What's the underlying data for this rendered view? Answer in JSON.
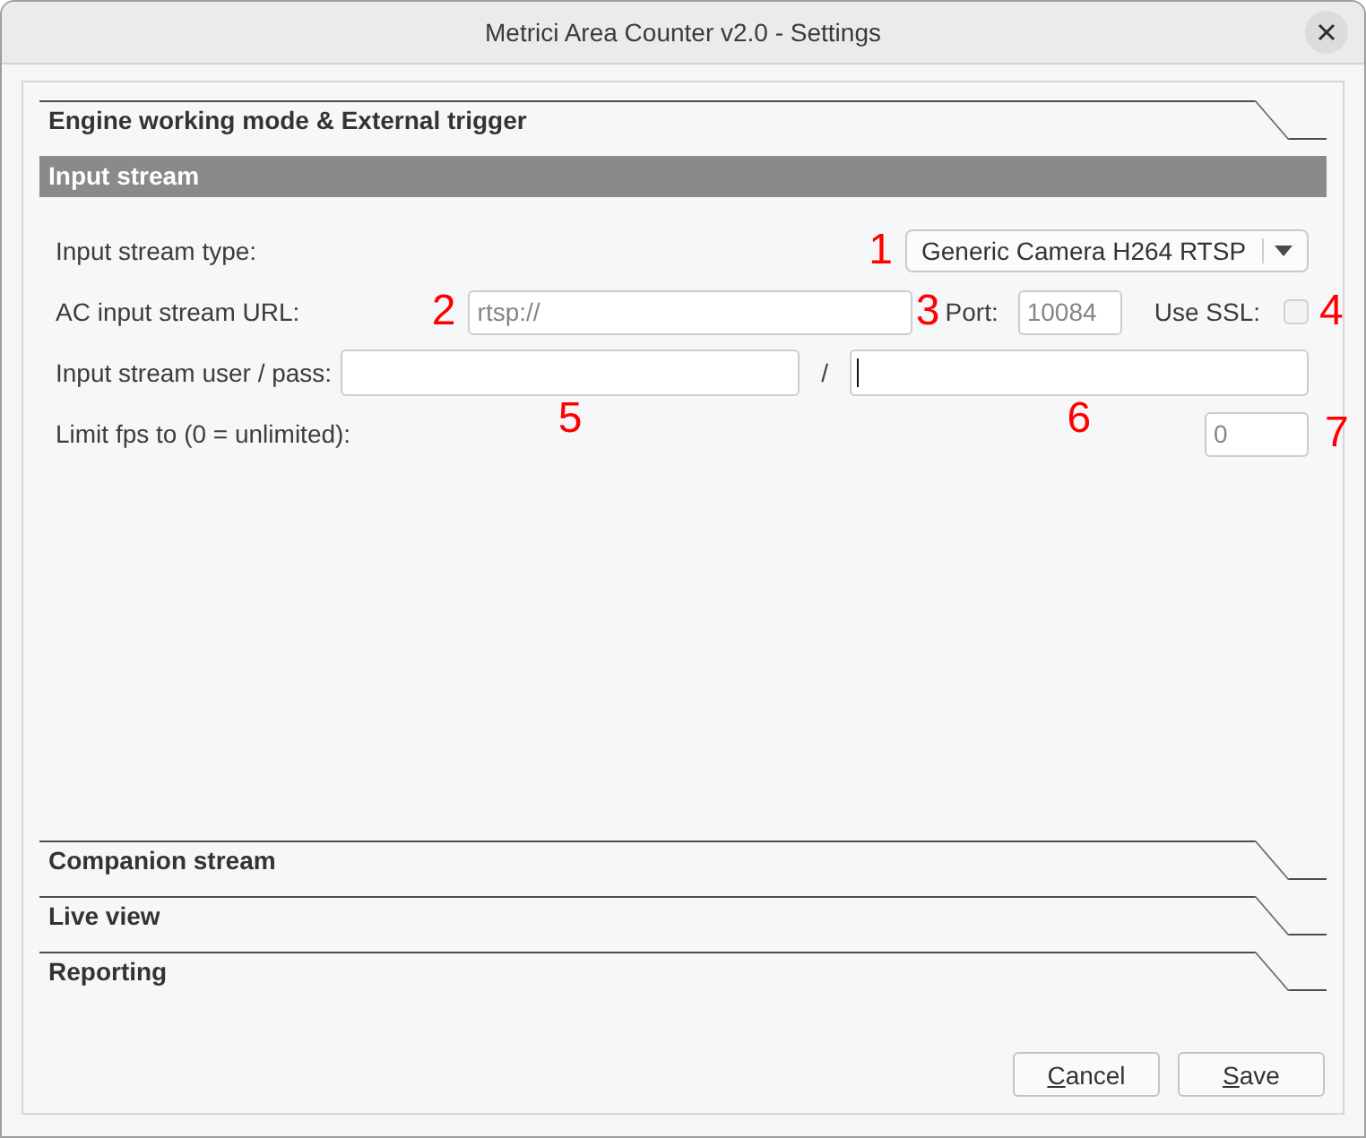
{
  "window": {
    "title": "Metrici Area Counter v2.0 - Settings"
  },
  "sections": [
    {
      "title": "Engine working mode & External trigger",
      "expanded": false
    },
    {
      "title": "Input stream",
      "expanded": true,
      "rows": [
        {
          "kind": "select",
          "label": "Input stream type:",
          "value": "Generic Camera H264 RTSP",
          "marker": "1"
        },
        {
          "kind": "url",
          "label": "AC input stream URL:",
          "url": {
            "placeholder": "rtsp://",
            "focused": false,
            "marker": "2"
          },
          "port": {
            "label": "Port:",
            "placeholder": "10084",
            "focused": false,
            "marker": "3"
          },
          "ssl": {
            "label": "Use SSL:",
            "checked": false,
            "marker": "4"
          }
        },
        {
          "kind": "credentials",
          "label": "Input stream user / pass:",
          "separator": "/",
          "user": {
            "focused": false,
            "marker": "5"
          },
          "pass": {
            "focused": true,
            "marker": "6"
          }
        },
        {
          "kind": "number",
          "label": "Limit fps to (0 = unlimited):",
          "placeholder": "0",
          "focused": false,
          "marker": "7"
        }
      ]
    },
    {
      "title": "Companion stream",
      "expanded": false
    },
    {
      "title": "Live view",
      "expanded": false
    },
    {
      "title": "Reporting",
      "expanded": false
    }
  ],
  "buttons": [
    {
      "label": "Cancel",
      "mnemonic": true
    },
    {
      "label": "Save",
      "mnemonic": true
    }
  ]
}
